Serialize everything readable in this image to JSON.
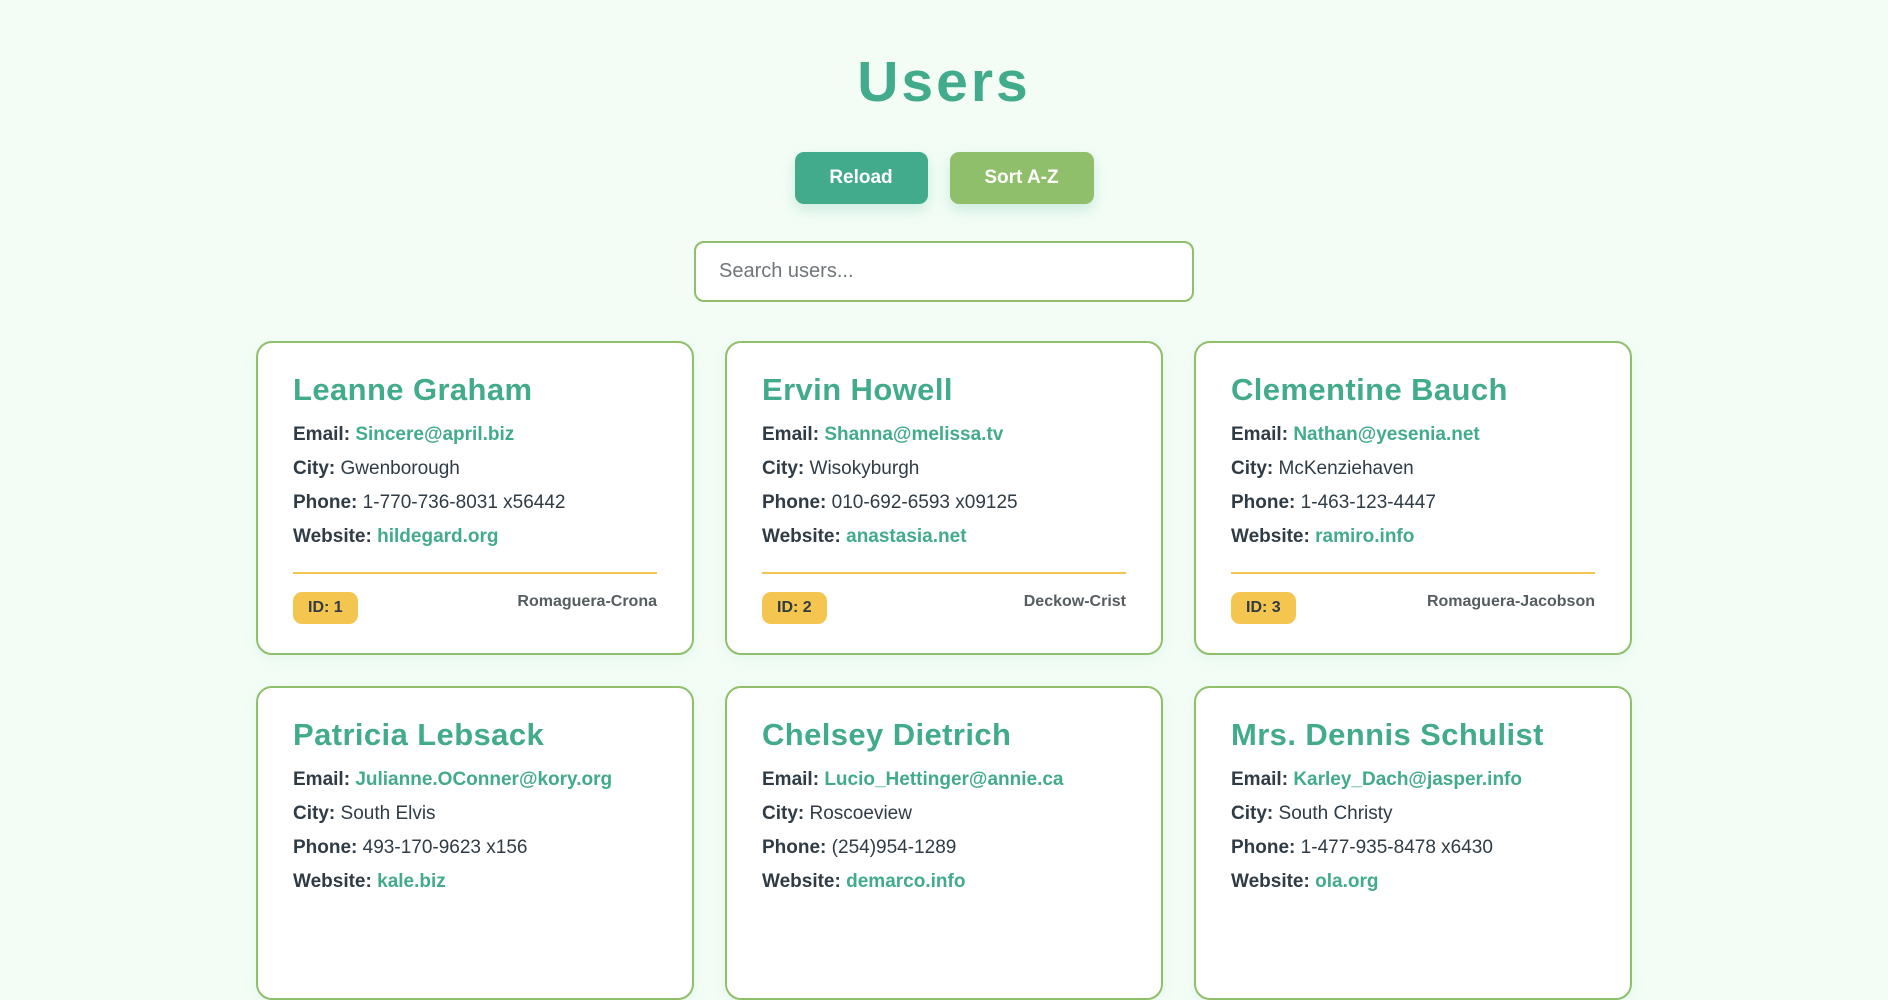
{
  "page": {
    "title": "Users"
  },
  "toolbar": {
    "reload_label": "Reload",
    "sort_label": "Sort A-Z"
  },
  "search": {
    "placeholder": "Search users...",
    "value": ""
  },
  "fields": {
    "email_label": "Email:",
    "city_label": "City:",
    "phone_label": "Phone:",
    "website_label": "Website:"
  },
  "users": [
    {
      "name": "Leanne Graham",
      "email": "Sincere@april.biz",
      "city": "Gwenborough",
      "phone": "1-770-736-8031 x56442",
      "website": "hildegard.org",
      "id_label": "ID: 1",
      "company": "Romaguera-Crona"
    },
    {
      "name": "Ervin Howell",
      "email": "Shanna@melissa.tv",
      "city": "Wisokyburgh",
      "phone": "010-692-6593 x09125",
      "website": "anastasia.net",
      "id_label": "ID: 2",
      "company": "Deckow-Crist"
    },
    {
      "name": "Clementine Bauch",
      "email": "Nathan@yesenia.net",
      "city": "McKenziehaven",
      "phone": "1-463-123-4447",
      "website": "ramiro.info",
      "id_label": "ID: 3",
      "company": "Romaguera-Jacobson"
    },
    {
      "name": "Patricia Lebsack",
      "email": "Julianne.OConner@kory.org",
      "city": "South Elvis",
      "phone": "493-170-9623 x156",
      "website": "kale.biz",
      "id_label": "",
      "company": ""
    },
    {
      "name": "Chelsey Dietrich",
      "email": "Lucio_Hettinger@annie.ca",
      "city": "Roscoeview",
      "phone": "(254)954-1289",
      "website": "demarco.info",
      "id_label": "",
      "company": ""
    },
    {
      "name": "Mrs. Dennis Schulist",
      "email": "Karley_Dach@jasper.info",
      "city": "South Christy",
      "phone": "1-477-935-8478 x6430",
      "website": "ola.org",
      "id_label": "",
      "company": ""
    }
  ],
  "colors": {
    "background": "#f3fdf6",
    "primary": "#42ab8b",
    "secondary": "#8fbf6a",
    "accent": "#f5c64f",
    "text": "#2f3b45"
  }
}
